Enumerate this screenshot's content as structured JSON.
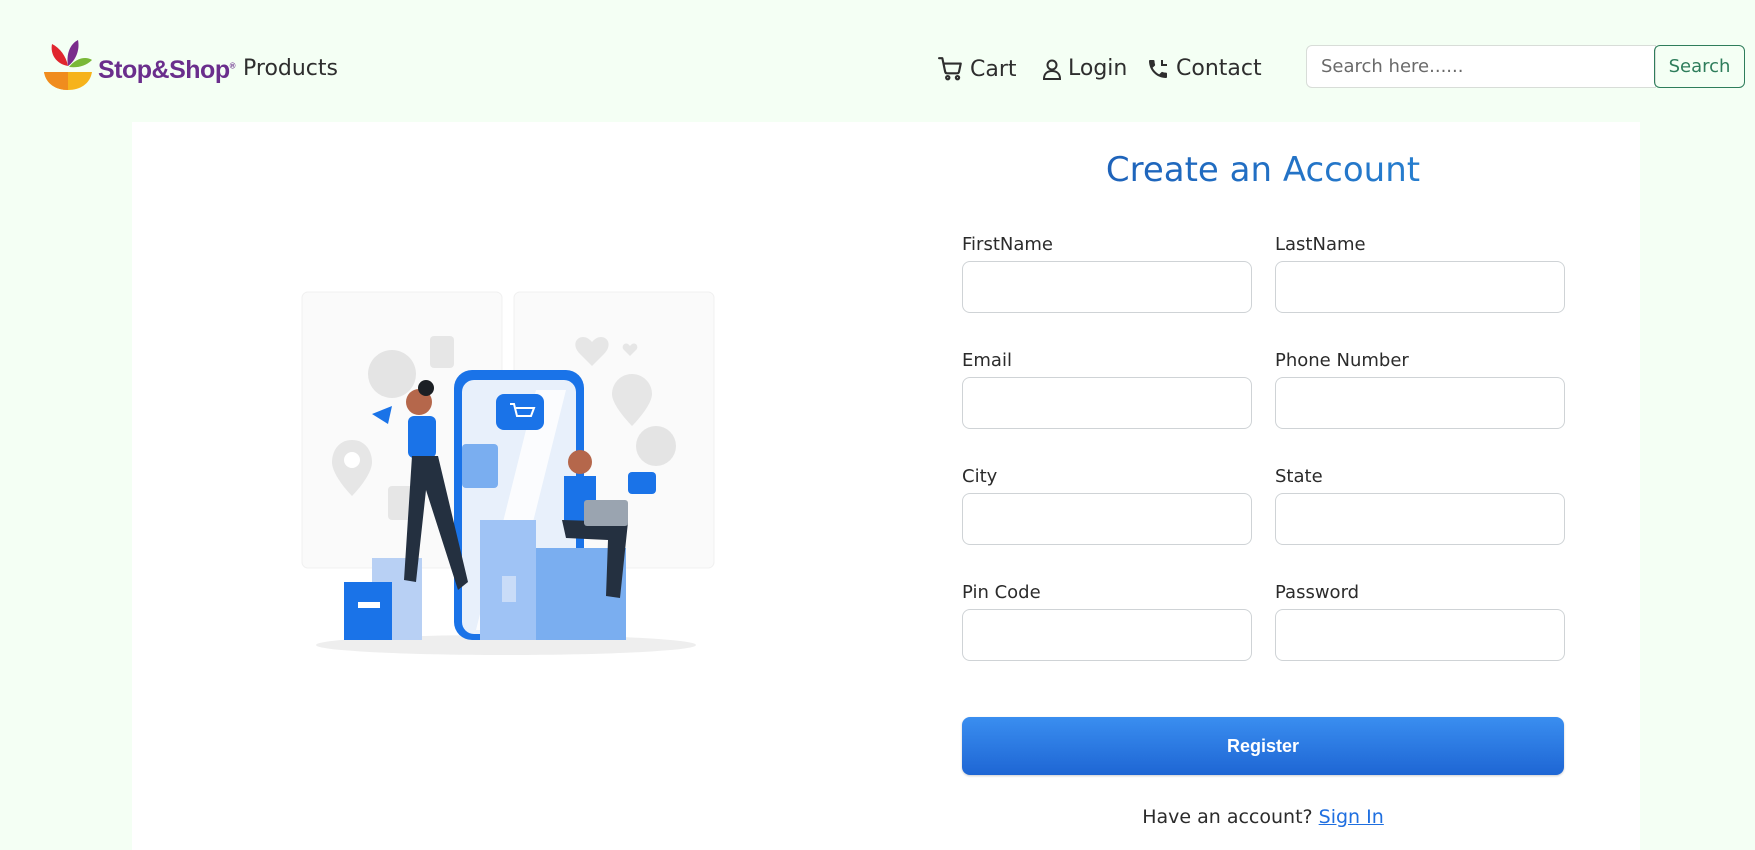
{
  "header": {
    "logo_text": "Stop&Shop",
    "logo_trademark": "®",
    "products_label": "Products",
    "cart_label": "Cart",
    "login_label": "Login",
    "contact_label": "Contact",
    "search_placeholder": "Search here......",
    "search_button": "Search"
  },
  "form": {
    "title": "Create an Account",
    "first_name_label": "FirstName",
    "last_name_label": "LastName",
    "email_label": "Email",
    "phone_label": "Phone Number",
    "city_label": "City",
    "state_label": "State",
    "pin_label": "Pin Code",
    "password_label": "Password",
    "first_name_value": "",
    "last_name_value": "",
    "email_value": "",
    "phone_value": "",
    "city_value": "",
    "state_value": "",
    "pin_value": "",
    "password_value": "",
    "register_button": "Register",
    "have_account_text": "Have an account?",
    "sign_in_link": "Sign In"
  },
  "colors": {
    "background": "#f4fff4",
    "accent_blue": "#1e66d4",
    "search_green": "#2e7d5b",
    "logo_purple": "#6a2e8c"
  },
  "icons": {
    "cart": "cart-icon",
    "login": "user-icon",
    "contact": "phone-icon"
  }
}
